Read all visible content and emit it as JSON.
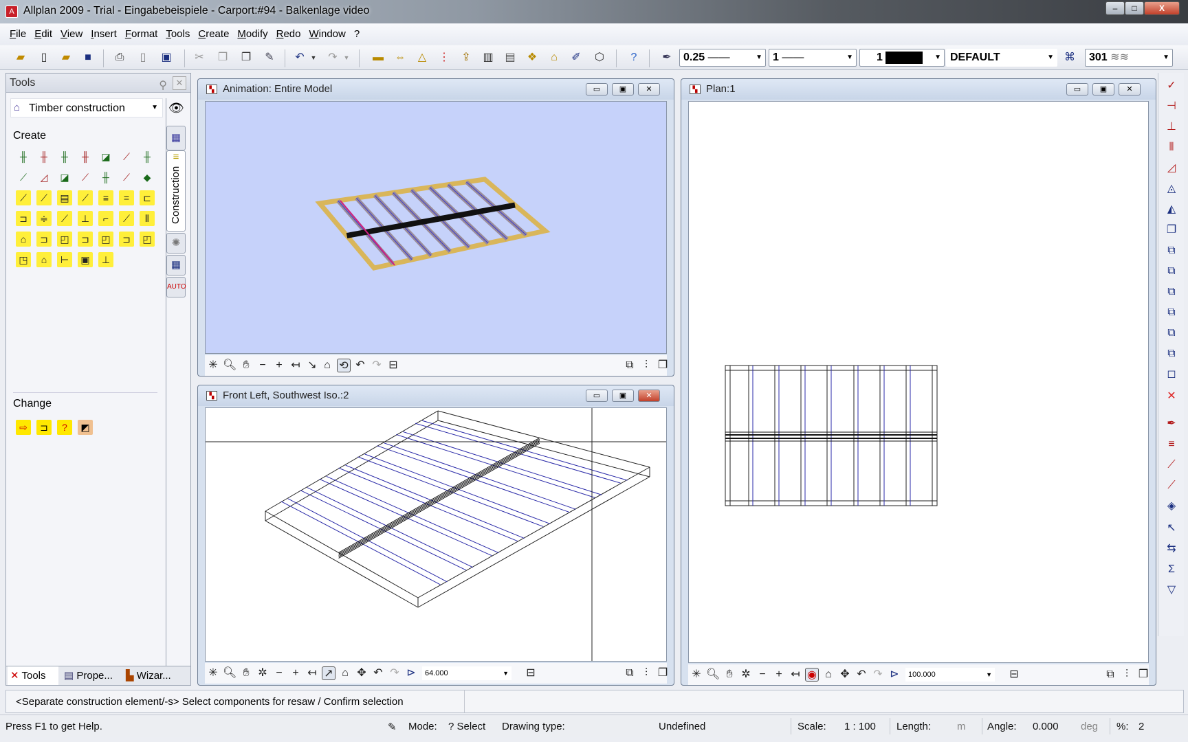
{
  "window": {
    "title": "Allplan 2009 - Trial - Eingabebeispiele - Carport:#94 - Balkenlage video",
    "controls": {
      "minimize": "–",
      "maximize": "□",
      "close": "X"
    }
  },
  "menu": [
    "File",
    "Edit",
    "View",
    "Insert",
    "Format",
    "Tools",
    "Create",
    "Modify",
    "Redo",
    "Window",
    "?"
  ],
  "toolbar": {
    "pen_thickness": "0.25",
    "line_type": "1",
    "color": "1",
    "layer": "DEFAULT",
    "hatch": "301"
  },
  "tools_panel": {
    "title": "Tools",
    "module": "Timber construction",
    "create_label": "Create",
    "change_label": "Change",
    "side_tab": "Construction",
    "bottom_tabs": [
      "Tools",
      "Prope...",
      "Wizar..."
    ]
  },
  "windows": {
    "animation": {
      "title": "Animation: Entire Model"
    },
    "front_left": {
      "title": "Front Left, Southwest Iso.:2",
      "zoom": "64.000"
    },
    "plan": {
      "title": "Plan:1",
      "zoom": "100.000"
    }
  },
  "command_line": "<Separate construction element/-s> Select components for resaw / Confirm selection",
  "status": {
    "help": "Press F1 to get Help.",
    "mode_label": "Mode:",
    "mode_value": "? Select",
    "drawing_type_label": "Drawing type:",
    "drawing_type_value": "Undefined",
    "scale_label": "Scale:",
    "scale_value": "1 : 100",
    "length_label": "Length:",
    "length_unit": "m",
    "angle_label": "Angle:",
    "angle_value": "0.000",
    "angle_unit": "deg",
    "percent_label": "%:",
    "percent_value": "2"
  },
  "colors": {
    "accent": "#c8202a",
    "animation_bg": "#c6d2fa",
    "beam": "#d9b65a",
    "wire_blue": "#2a2aa8"
  }
}
